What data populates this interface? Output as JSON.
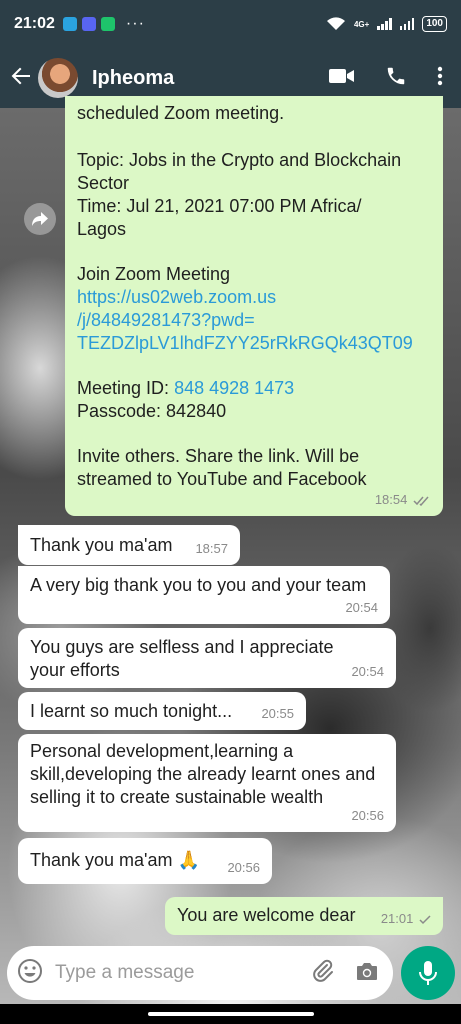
{
  "status_bar": {
    "time": "21:02",
    "dots": "···",
    "network": "4G+",
    "battery": "100"
  },
  "header": {
    "contact_name": "Ipheoma",
    "back_icon": "arrow-left-icon",
    "video_icon": "video-camera-icon",
    "call_icon": "phone-icon",
    "menu_icon": "more-vertical-icon"
  },
  "messages": [
    {
      "direction": "out",
      "line_top": "scheduled Zoom meeting.",
      "topic": "Topic: Jobs in the Crypto and Blockchain Sector",
      "time_line": "Time: Jul 21, 2021 07:00 PM Africa/ Lagos",
      "join_label": "Join Zoom Meeting",
      "link_1": "https://us02web.zoom.us",
      "link_2": "/j/84849281473?pwd=",
      "link_3": "TEZDZlpLV1lhdFZYY25rRkRGQk43QT09",
      "meeting_id_label": "Meeting ID:",
      "meeting_id": "848 4928 1473",
      "passcode": "Passcode: 842840",
      "invite": "Invite others. Share the link. Will be streamed to YouTube and Facebook",
      "time": "18:54"
    },
    {
      "direction": "in",
      "text": "Thank you ma'am",
      "time": "18:57"
    },
    {
      "direction": "in",
      "text": "A very big thank you to you and your team",
      "time": "20:54"
    },
    {
      "direction": "in",
      "text": "You guys are selfless and I appreciate your efforts",
      "time": "20:54"
    },
    {
      "direction": "in",
      "text": "I learnt so much tonight...",
      "time": "20:55"
    },
    {
      "direction": "in",
      "text": "Personal development,learning a skill,developing the already learnt ones and selling it to create sustainable wealth",
      "time": "20:56"
    },
    {
      "direction": "in",
      "text": "Thank you ma'am 🙏",
      "time": "20:56"
    },
    {
      "direction": "out",
      "text": "You are welcome dear",
      "time": "21:01"
    }
  ],
  "composer": {
    "placeholder": "Type a message"
  },
  "colors": {
    "header": "#2c3e47",
    "outgoing_bubble": "#dcf8c6",
    "incoming_bubble": "#ffffff",
    "link": "#2a9ad8",
    "mic_button": "#00a884"
  }
}
